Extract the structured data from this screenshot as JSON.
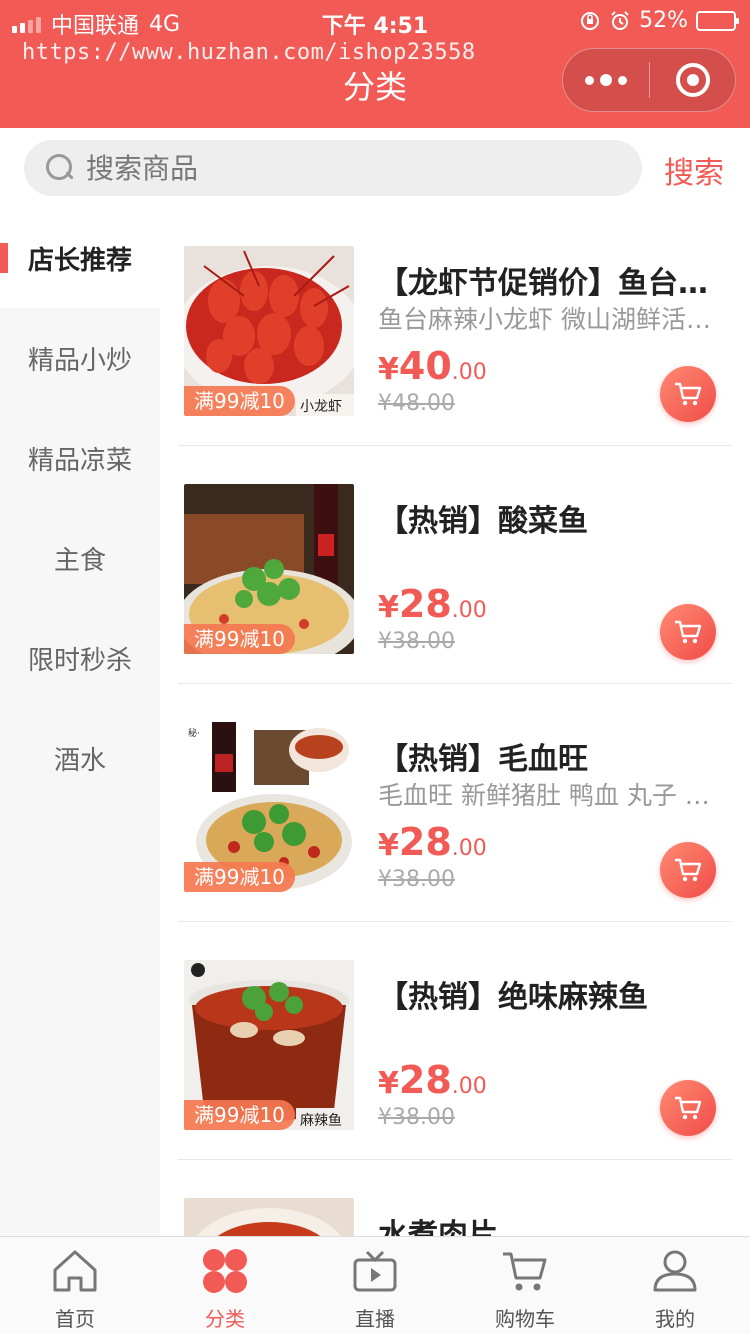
{
  "status_bar": {
    "carrier": "中国联通",
    "network": "4G",
    "time": "下午 4:51",
    "battery": "52%"
  },
  "header": {
    "url": "https://www.huzhan.com/ishop23558",
    "title": "分类"
  },
  "search": {
    "placeholder": "搜索商品",
    "button": "搜索"
  },
  "sidebar": {
    "items": [
      {
        "label": "店长推荐",
        "active": true
      },
      {
        "label": "精品小炒"
      },
      {
        "label": "精品凉菜"
      },
      {
        "label": "主食"
      },
      {
        "label": "限时秒杀"
      },
      {
        "label": "酒水"
      }
    ]
  },
  "products": [
    {
      "title": "【龙虾节促销价】鱼台麻辣小龙虾",
      "desc": "鱼台麻辣小龙虾 微山湖鲜活小龙虾",
      "price_currency": "¥",
      "price_int": "40",
      "price_dec": ".00",
      "original": "¥48.00",
      "badge": "满99减10",
      "img_text": "小龙虾"
    },
    {
      "title": "【热销】酸菜鱼",
      "desc": "",
      "price_currency": "¥",
      "price_int": "28",
      "price_dec": ".00",
      "original": "¥38.00",
      "badge": "满99减10"
    },
    {
      "title": "【热销】毛血旺",
      "desc": "毛血旺 新鲜猪肚 鸭血 丸子 …",
      "price_currency": "¥",
      "price_int": "28",
      "price_dec": ".00",
      "original": "¥38.00",
      "badge": "满99减10"
    },
    {
      "title": "【热销】绝味麻辣鱼",
      "desc": "",
      "price_currency": "¥",
      "price_int": "28",
      "price_dec": ".00",
      "original": "¥38.00",
      "badge": "满99减10",
      "img_text": "麻辣鱼"
    },
    {
      "title": "水煮肉片",
      "desc": ""
    }
  ],
  "tabbar": {
    "items": [
      {
        "label": "首页",
        "icon": "home-icon"
      },
      {
        "label": "分类",
        "icon": "category-icon",
        "active": true
      },
      {
        "label": "直播",
        "icon": "tv-icon"
      },
      {
        "label": "购物车",
        "icon": "cart-icon"
      },
      {
        "label": "我的",
        "icon": "profile-icon"
      }
    ]
  },
  "colors": {
    "brand": "#f25a56",
    "badge": "#f57850"
  }
}
